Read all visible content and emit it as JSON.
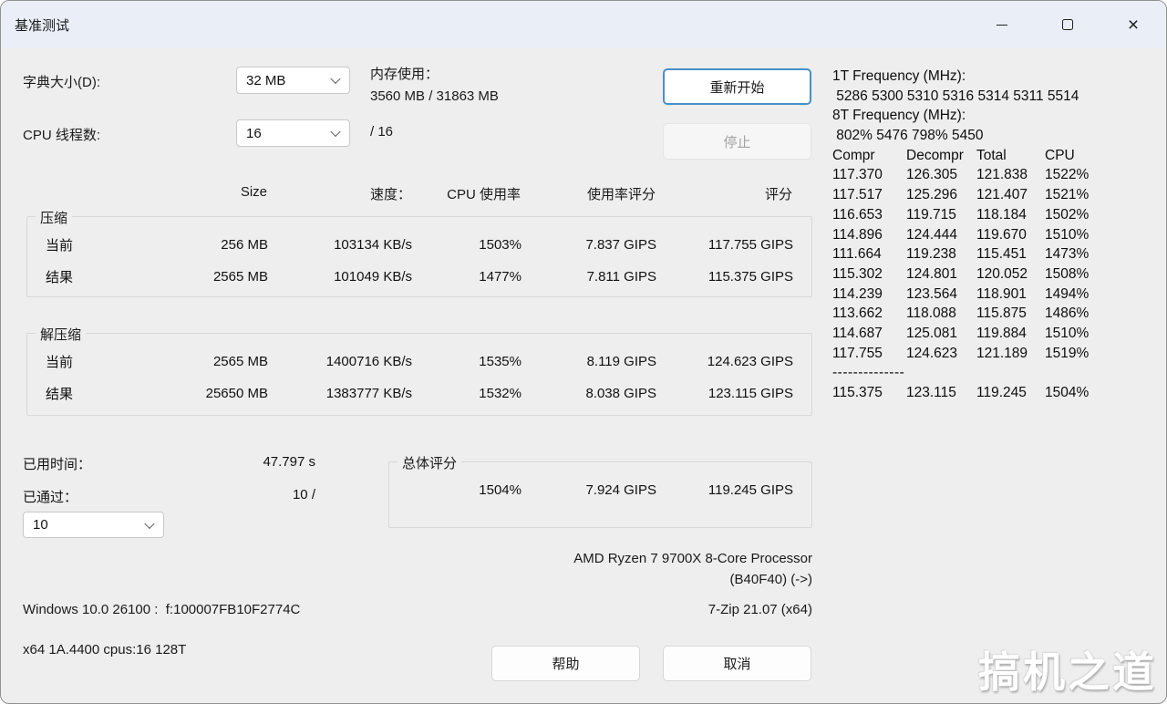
{
  "window": {
    "title": "基准测试"
  },
  "top": {
    "dictionary_label": "字典大小(D):",
    "dictionary_value": "32 MB",
    "threads_label": "CPU 线程数:",
    "threads_value": "16",
    "threads_suffix": "/ 16",
    "memory_label": "内存使用：",
    "memory_value": "3560 MB / 31863 MB",
    "restart_button": "重新开始",
    "stop_button": "停止"
  },
  "bench_table": {
    "headers": [
      "Size",
      "速度：",
      "CPU 使用率",
      "使用率评分",
      "评分"
    ],
    "groups": [
      {
        "title": "压缩",
        "rows": [
          {
            "label": "当前",
            "values": [
              "256 MB",
              "103134 KB/s",
              "1503%",
              "7.837 GIPS",
              "117.755 GIPS"
            ]
          },
          {
            "label": "结果",
            "values": [
              "2565 MB",
              "101049 KB/s",
              "1477%",
              "7.811 GIPS",
              "115.375 GIPS"
            ]
          }
        ]
      },
      {
        "title": "解压缩",
        "rows": [
          {
            "label": "当前",
            "values": [
              "2565 MB",
              "1400716 KB/s",
              "1535%",
              "8.119 GIPS",
              "124.623 GIPS"
            ]
          },
          {
            "label": "结果",
            "values": [
              "25650 MB",
              "1383777 KB/s",
              "1532%",
              "8.038 GIPS",
              "123.115 GIPS"
            ]
          }
        ]
      }
    ]
  },
  "right_panel": {
    "freq_lines": [
      "1T Frequency (MHz):",
      " 5286 5300 5310 5316 5314 5311 5514",
      "8T Frequency (MHz):",
      " 802% 5476 798% 5450"
    ],
    "table_header": [
      "Compr",
      "Decompr",
      "Total",
      "CPU"
    ],
    "rows": [
      [
        "117.370",
        "126.305",
        "121.838",
        "1522%"
      ],
      [
        "117.517",
        "125.296",
        "121.407",
        "1521%"
      ],
      [
        "116.653",
        "119.715",
        "118.184",
        "1502%"
      ],
      [
        "114.896",
        "124.444",
        "119.670",
        "1510%"
      ],
      [
        "111.664",
        "119.238",
        "115.451",
        "1473%"
      ],
      [
        "115.302",
        "124.801",
        "120.052",
        "1508%"
      ],
      [
        "114.239",
        "123.564",
        "118.901",
        "1494%"
      ],
      [
        "113.662",
        "118.088",
        "115.875",
        "1486%"
      ],
      [
        "114.687",
        "125.081",
        "119.884",
        "1510%"
      ],
      [
        "117.755",
        "124.623",
        "121.189",
        "1519%"
      ]
    ],
    "separator": "--------------",
    "total_row": [
      "115.375",
      "123.115",
      "119.245",
      "1504%"
    ]
  },
  "bottom": {
    "elapsed_label": "已用时间：",
    "elapsed_value": "47.797 s",
    "passes_label": "已通过：",
    "passes_value": "10 /",
    "passes_dropdown_value": "10",
    "total_group_title": "总体评分",
    "total_values": [
      "1504%",
      "7.924 GIPS",
      "119.245 GIPS"
    ],
    "cpu_name": "AMD Ryzen 7 9700X 8-Core Processor",
    "cpu_id": "(B40F40) (->)",
    "os_line": "Windows 10.0 26100 :  f:100007FB10F2774C",
    "app_version": "7-Zip 21.07 (x64)",
    "arch_line": "x64 1A.4400 cpus:16 128T",
    "help_button": "帮助",
    "cancel_button": "取消"
  },
  "watermark": "搞机之道",
  "colors": {
    "accent": "#4a8fc7",
    "titlebar": "#e9eef7",
    "client_bg": "#eeeeee",
    "disabled_text": "#a2a2a2"
  }
}
